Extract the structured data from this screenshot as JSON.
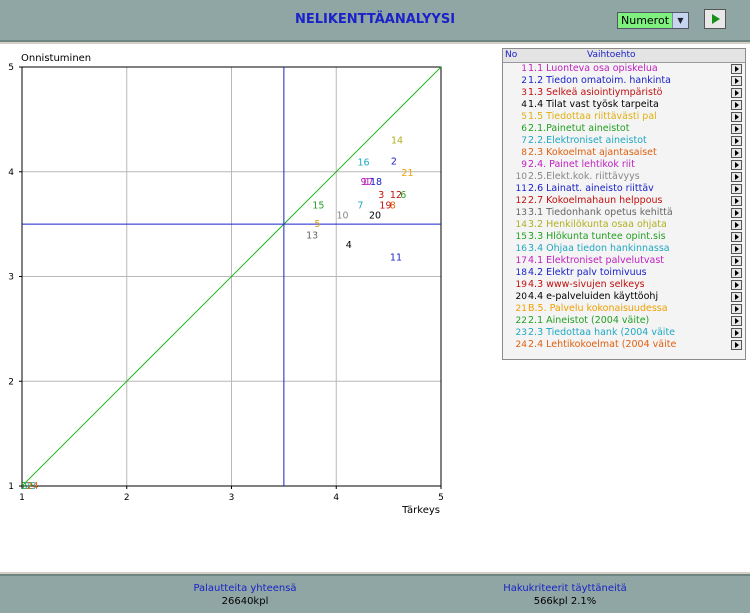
{
  "header": {
    "title": "NELIKENTTÄANALYYSI",
    "select_value": "Numerot"
  },
  "colors": {
    "diagonal": "#22b822",
    "quadrant_lines": "#1a22c8",
    "grid": "#b8b8b8",
    "header_bg": "#8fa6a4"
  },
  "chart_data": {
    "type": "scatter",
    "xlabel": "Tärkeys",
    "ylabel": "Onnistuminen",
    "xlim": [
      1,
      5
    ],
    "ylim": [
      1,
      5
    ],
    "xticks": [
      "1",
      "2",
      "3",
      "4",
      "5"
    ],
    "yticks": [
      "1",
      "2",
      "3",
      "4",
      "5"
    ],
    "grid": true,
    "quadrant_split": {
      "x": 3.5,
      "y": 3.5
    },
    "diagonal": [
      [
        1,
        1
      ],
      [
        5,
        5
      ]
    ],
    "points": [
      {
        "label": "1",
        "x": 4.3,
        "y": 3.9,
        "color": "#c020c0"
      },
      {
        "label": "2",
        "x": 4.55,
        "y": 4.1,
        "color": "#1a22c8"
      },
      {
        "label": "3",
        "x": 4.43,
        "y": 3.78,
        "color": "#c01010"
      },
      {
        "label": "4",
        "x": 4.12,
        "y": 3.3,
        "color": "#000000"
      },
      {
        "label": "5",
        "x": 3.82,
        "y": 3.5,
        "color": "#e0a010"
      },
      {
        "label": "6",
        "x": 4.64,
        "y": 3.78,
        "color": "#22a022"
      },
      {
        "label": "7",
        "x": 4.23,
        "y": 3.68,
        "color": "#20a8c0"
      },
      {
        "label": "8",
        "x": 4.54,
        "y": 3.68,
        "color": "#e06010"
      },
      {
        "label": "9",
        "x": 4.26,
        "y": 3.9,
        "color": "#c020c0"
      },
      {
        "label": "10",
        "x": 4.06,
        "y": 3.58,
        "color": "#888888"
      },
      {
        "label": "11",
        "x": 4.57,
        "y": 3.18,
        "color": "#1a22c8"
      },
      {
        "label": "12",
        "x": 4.57,
        "y": 3.78,
        "color": "#c01010"
      },
      {
        "label": "13",
        "x": 3.77,
        "y": 3.39,
        "color": "#666666"
      },
      {
        "label": "14",
        "x": 4.58,
        "y": 4.3,
        "color": "#b0b020"
      },
      {
        "label": "15",
        "x": 3.83,
        "y": 3.68,
        "color": "#22a022"
      },
      {
        "label": "16",
        "x": 4.26,
        "y": 4.09,
        "color": "#20a8c0"
      },
      {
        "label": "17",
        "x": 4.3,
        "y": 3.9,
        "color": "#c020c0"
      },
      {
        "label": "18",
        "x": 4.38,
        "y": 3.9,
        "color": "#1a22c8"
      },
      {
        "label": "19",
        "x": 4.47,
        "y": 3.68,
        "color": "#c01010"
      },
      {
        "label": "20",
        "x": 4.37,
        "y": 3.58,
        "color": "#000000"
      },
      {
        "label": "21",
        "x": 4.68,
        "y": 3.99,
        "color": "#f0a000"
      },
      {
        "label": "22",
        "x": 1.05,
        "y": 1.0,
        "color": "#22a022"
      },
      {
        "label": "23",
        "x": 1.08,
        "y": 1.0,
        "color": "#20a8c0"
      },
      {
        "label": "24",
        "x": 1.1,
        "y": 1.0,
        "color": "#e06010"
      }
    ]
  },
  "list": {
    "col_no": "No",
    "col_option": "Vaihtoehto",
    "items": [
      {
        "no": "1",
        "label": "1.1 Luonteva osa opiskelua",
        "color": "#c020c0"
      },
      {
        "no": "2",
        "label": "1.2 Tiedon omatoim. hankinta",
        "color": "#1a22c8"
      },
      {
        "no": "3",
        "label": "1.3 Selkeä asiointiympäristö",
        "color": "#c01010"
      },
      {
        "no": "4",
        "label": "1.4 Tilat vast työsk tarpeita",
        "color": "#000000"
      },
      {
        "no": "5",
        "label": "1.5 Tiedottaa riittävästi pal",
        "color": "#e0b010"
      },
      {
        "no": "6",
        "label": "2.1.Painetut aineistot",
        "color": "#22a022"
      },
      {
        "no": "7",
        "label": "2.2.Elektroniset aineistot",
        "color": "#20a8c0"
      },
      {
        "no": "8",
        "label": "2.3 Kokoelmat ajantasaiset",
        "color": "#e06010"
      },
      {
        "no": "9",
        "label": "2.4. Painet lehtikok riit",
        "color": "#c020c0"
      },
      {
        "no": "10",
        "label": "2.5.Elekt.kok. riittävyys",
        "color": "#888888"
      },
      {
        "no": "11",
        "label": "2.6 Lainatt. aineisto riittäv",
        "color": "#1a22c8"
      },
      {
        "no": "12",
        "label": "2.7 Kokoelmahaun helppous",
        "color": "#c01010"
      },
      {
        "no": "13",
        "label": "3.1 Tiedonhank opetus kehittä",
        "color": "#666666"
      },
      {
        "no": "14",
        "label": "3.2 Henkilökunta osaa ohjata",
        "color": "#b0b020"
      },
      {
        "no": "15",
        "label": "3.3 Hlökunta tuntee opint.sis",
        "color": "#22a022"
      },
      {
        "no": "16",
        "label": "3.4 Ohjaa tiedon hankinnassa",
        "color": "#20a8c0"
      },
      {
        "no": "17",
        "label": "4.1 Elektroniset palvelutvast",
        "color": "#c020c0"
      },
      {
        "no": "18",
        "label": "4.2 Elektr palv toimivuus",
        "color": "#1a22c8"
      },
      {
        "no": "19",
        "label": "4.3 www-sivujen selkeys",
        "color": "#c01010"
      },
      {
        "no": "20",
        "label": "4.4 e-palveluiden käyttöohj",
        "color": "#000000"
      },
      {
        "no": "21",
        "label": "B.5. Palvelu kokonaisuudessa",
        "color": "#f0a000"
      },
      {
        "no": "22",
        "label": "2.1 Aineistot (2004 väite)",
        "color": "#22a022"
      },
      {
        "no": "23",
        "label": "2.3 Tiedottaa hank (2004 väite",
        "color": "#20a8c0"
      },
      {
        "no": "24",
        "label": "2.4 Lehtikokoelmat (2004 väite",
        "color": "#e06010"
      }
    ]
  },
  "footer": {
    "left_title": "Palautteita yhteensä",
    "left_value": "26640kpl",
    "right_title": "Hakukriteerit täyttäneitä",
    "right_value": "566kpl  2.1%"
  }
}
